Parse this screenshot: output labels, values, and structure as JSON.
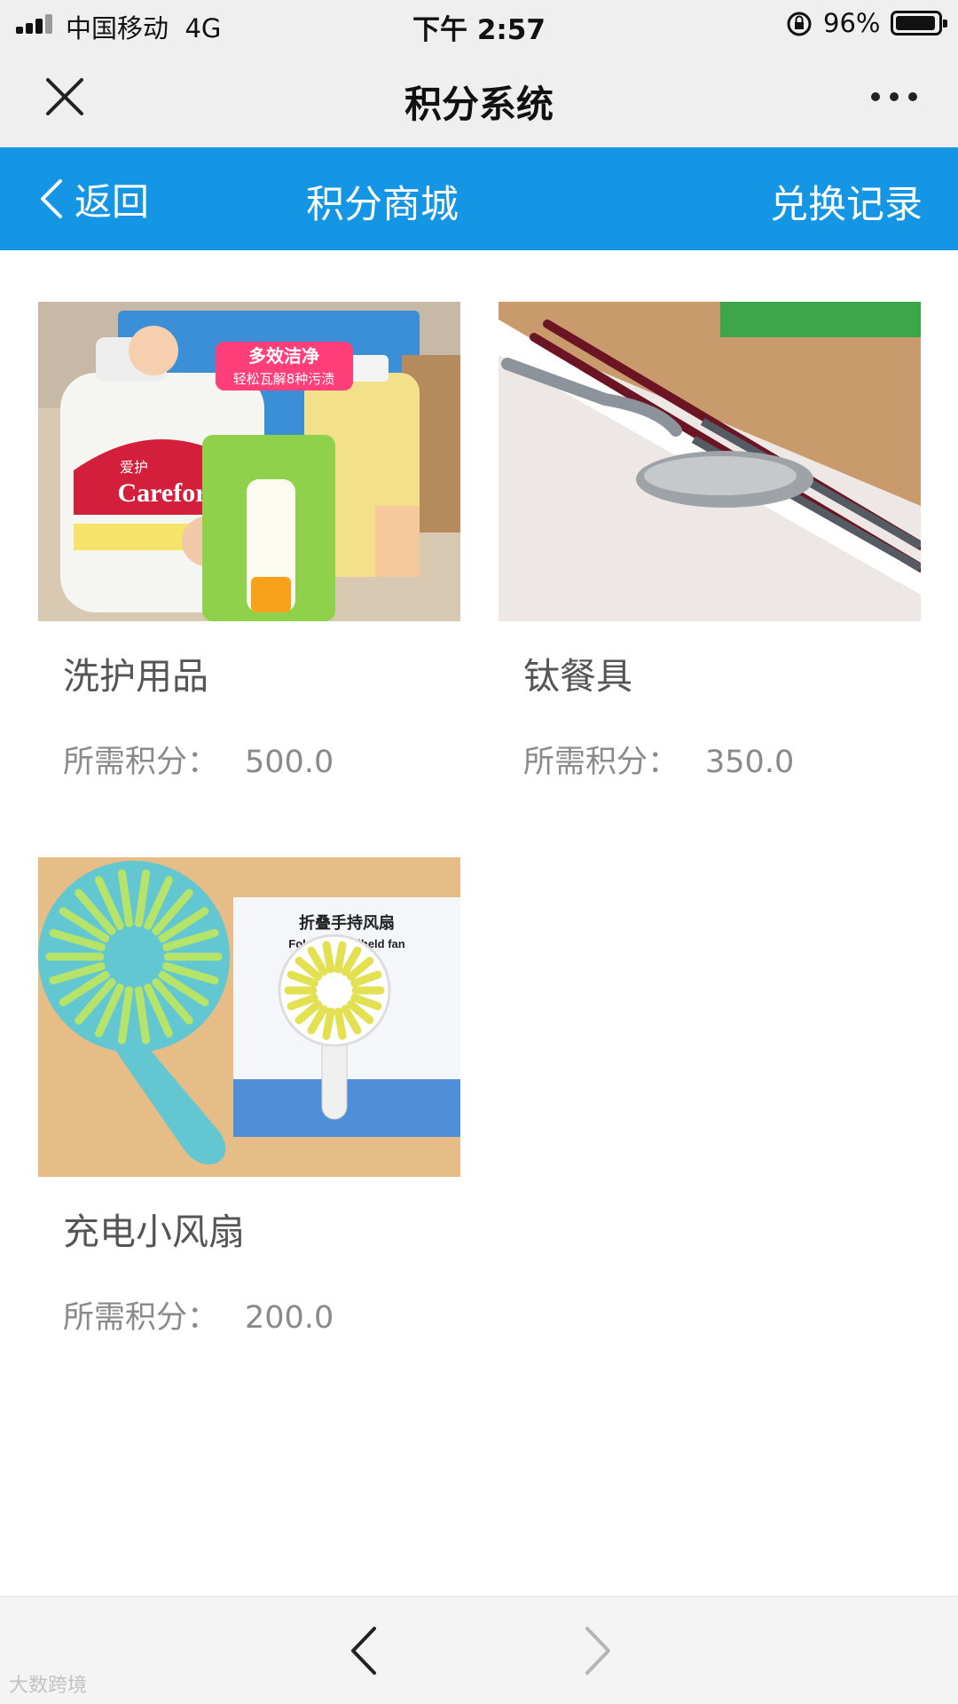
{
  "status_bar": {
    "carrier": "中国移动",
    "network": "4G",
    "time": "下午 2:57",
    "battery_percent": "96%",
    "battery_level": 0.96,
    "signal_icon": "signal-bars-icon",
    "lock_icon": "rotation-lock-icon"
  },
  "wechat_bar": {
    "title": "积分系统",
    "close_icon": "close-icon",
    "more_icon": "more-dots-icon"
  },
  "app_header": {
    "back_label": "返回",
    "title": "积分商城",
    "history_label": "兑换记录",
    "background_color": "#1596e5"
  },
  "products": [
    {
      "name": "洗护用品",
      "points_label": "所需积分：",
      "points": "500.0",
      "image": "baby laundry detergent bottles"
    },
    {
      "name": "钛餐具",
      "points_label": "所需积分：",
      "points": "350.0",
      "image": "titanium chopsticks and spoon"
    },
    {
      "name": "充电小风扇",
      "points_label": "所需积分：",
      "points": "200.0",
      "image": "folding handheld fan"
    }
  ],
  "image_text": {
    "brand": "Carefor",
    "brand_cn": "爱护",
    "promo_line1": "多效洁净",
    "promo_line2": "轻松瓦解8种污渍",
    "fan_box_cn": "折叠手持风扇",
    "fan_box_en": "Folding handheld fan"
  },
  "bottom_nav": {
    "back_icon": "chevron-left-icon",
    "forward_icon": "chevron-right-icon"
  },
  "watermark": "大数跨境",
  "colors": {
    "accent": "#1596e5",
    "bar_bg": "#efefef"
  }
}
